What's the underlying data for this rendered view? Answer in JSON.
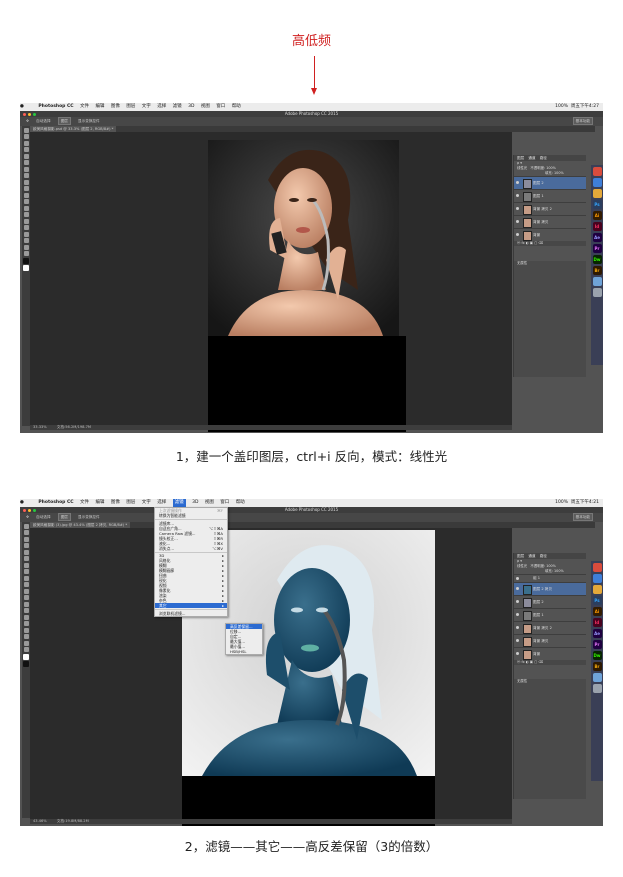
{
  "header": {
    "title": "高低频"
  },
  "captions": {
    "step1": "1，建一个盖印图层，ctrl+i 反向，模式：线性光",
    "step2": "2，滤镜——其它——高反差保留（3的倍数）"
  },
  "app": {
    "name": "Photoshop CC",
    "window_title": "Adobe Photoshop CC 2015",
    "menus": [
      "文件",
      "编辑",
      "图像",
      "图层",
      "文字",
      "选择",
      "滤镜",
      "3D",
      "视图",
      "窗口",
      "帮助"
    ],
    "menus_short": [
      "文件",
      "编辑",
      "图像",
      "图层",
      "文字",
      "选择",
      "滤镜",
      "3D",
      "视图",
      "窗口",
      "帮助"
    ],
    "clock_1": "周五下午4:27",
    "clock_2": "周五下午4:21",
    "zoom_status": "100%",
    "options": {
      "auto_select": "自动选择",
      "layer": "图层",
      "show_transform": "显示变换控件",
      "workspace": "基本功能"
    }
  },
  "shot1": {
    "doc_tab": "欧美风格摄影.psd @ 33.3% (图层 2, RGB/8#) *",
    "status_zoom": "33.33%",
    "status_doc": "文档:56.2M/198.7M",
    "panel_tabs": [
      "图层",
      "通道",
      "路径"
    ],
    "blend_mode": "线性光",
    "opacity": "不透明度: 100%",
    "fill": "填充: 100%",
    "layers": [
      {
        "name": "图层 2"
      },
      {
        "name": "图层 1"
      },
      {
        "name": "背景 拷贝 2"
      },
      {
        "name": "背景 拷贝"
      },
      {
        "name": "背景"
      }
    ],
    "props_title": "无属性"
  },
  "shot2": {
    "doc_tab": "欧美风格摄影 (3).jpg @ 43.4% (图层 2 拷贝, RGB/8#) *",
    "status_zoom": "43.46%",
    "status_doc": "文档:19.8M/88.2M",
    "blend_mode": "线性光",
    "opacity": "不透明度: 100%",
    "fill": "填充: 100%",
    "layers": [
      {
        "name": "组 1"
      },
      {
        "name": "图层 2 拷贝"
      },
      {
        "name": "图层 2"
      },
      {
        "name": "图层 1"
      },
      {
        "name": "背景 拷贝 2"
      },
      {
        "name": "背景 拷贝"
      },
      {
        "name": "背景"
      }
    ],
    "props_title": "无属性",
    "filter_menu": [
      {
        "label": "上次滤镜操作",
        "shortcut": "⌘F",
        "dim": true
      },
      {
        "label": "转换为智能滤镜",
        "shortcut": ""
      },
      {
        "sep": true
      },
      {
        "label": "滤镜库...",
        "shortcut": ""
      },
      {
        "label": "自适应广角...",
        "shortcut": "⌥⇧⌘A"
      },
      {
        "label": "Camera Raw 滤镜...",
        "shortcut": "⇧⌘A"
      },
      {
        "label": "镜头校正...",
        "shortcut": "⇧⌘R"
      },
      {
        "label": "液化...",
        "shortcut": "⇧⌘X"
      },
      {
        "label": "消失点...",
        "shortcut": "⌥⌘V"
      },
      {
        "sep": true
      },
      {
        "label": "3D",
        "sub": true
      },
      {
        "label": "风格化",
        "sub": true
      },
      {
        "label": "模糊",
        "sub": true
      },
      {
        "label": "模糊画廊",
        "sub": true
      },
      {
        "label": "扭曲",
        "sub": true
      },
      {
        "label": "锐化",
        "sub": true
      },
      {
        "label": "视频",
        "sub": true
      },
      {
        "label": "像素化",
        "sub": true
      },
      {
        "label": "渲染",
        "sub": true
      },
      {
        "label": "杂色",
        "sub": true
      },
      {
        "label": "其它",
        "sub": true,
        "hl": true
      },
      {
        "sep": true
      },
      {
        "label": "浏览联机滤镜...",
        "shortcut": ""
      }
    ],
    "submenu": [
      "高反差保留...",
      "位移...",
      "自定...",
      "最大值...",
      "最小值...",
      "HSB/HSL"
    ]
  },
  "dock_icons": [
    "Ps",
    "Ai",
    "Id",
    "Ae",
    "Pr",
    "Dw",
    "Br"
  ],
  "colors": {
    "header_red": "#d02020",
    "ps_bg": "#535353",
    "selection_blue": "#2c6bd1"
  }
}
